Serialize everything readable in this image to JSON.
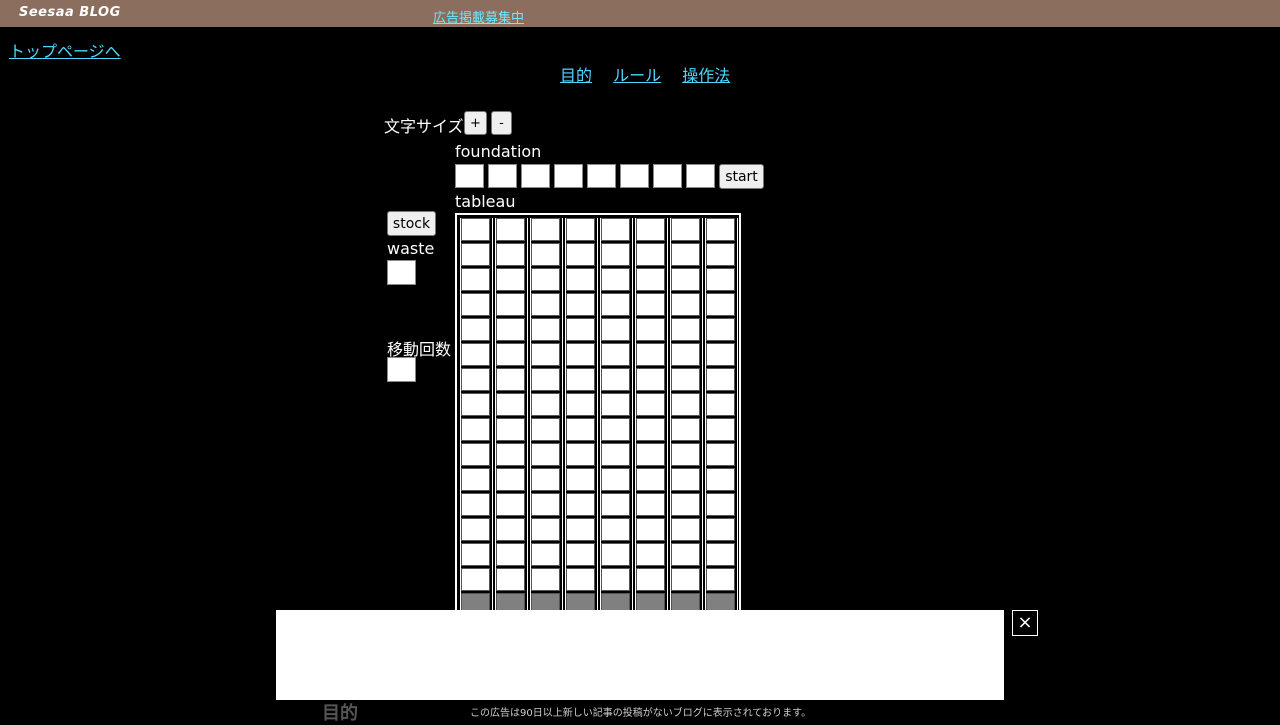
{
  "header": {
    "logo": "Seesaa BLOG",
    "ad_link": "広告掲載募集中"
  },
  "top_link": "トップページへ",
  "nav": {
    "purpose": "目的",
    "rules": "ルール",
    "howto": "操作法"
  },
  "font_size": {
    "label": "文字サイズ",
    "plus": "+",
    "minus": "-"
  },
  "foundation": {
    "label": "foundation",
    "slots": 8,
    "start_label": "start"
  },
  "tableau": {
    "label": "tableau",
    "columns": 8
  },
  "stock": {
    "label": "stock"
  },
  "waste": {
    "label": "waste"
  },
  "moves": {
    "label": "移動回数"
  },
  "ad": {
    "close": "×",
    "notice": "この広告は90日以上新しい記事の投稿がないブログに表示されております。"
  },
  "section_title": "目的"
}
